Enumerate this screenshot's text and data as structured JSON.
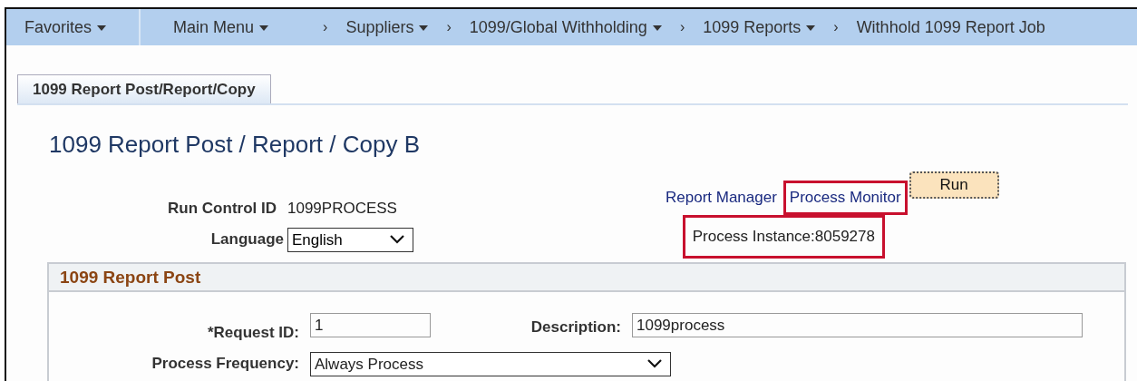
{
  "breadcrumb": [
    {
      "label": "Favorites",
      "dropdown": true
    },
    {
      "label": "Main Menu",
      "dropdown": true
    },
    {
      "label": "Suppliers",
      "dropdown": true,
      "separator": "›"
    },
    {
      "label": "1099/Global Withholding",
      "dropdown": true,
      "separator": "›"
    },
    {
      "label": "1099 Reports",
      "dropdown": true,
      "separator": "›"
    },
    {
      "label": "Withhold 1099 Report Job",
      "dropdown": false,
      "separator": "›"
    }
  ],
  "tabs": [
    {
      "label": "1099 Report Post/Report/Copy",
      "selected": true
    }
  ],
  "page_title": "1099 Report Post / Report / Copy B",
  "run_control": {
    "label": "Run Control ID",
    "value": "1099PROCESS"
  },
  "language": {
    "label": "Language",
    "value": "English"
  },
  "links": [
    {
      "label": "Report Manager",
      "highlighted": false
    },
    {
      "label": "Process Monitor",
      "highlighted": true
    }
  ],
  "run_button": "Run",
  "process_instance": {
    "text": "Process Instance:8059278",
    "highlighted": true
  },
  "group": {
    "title": "1099 Report Post",
    "request_id": {
      "label": "*Request ID:",
      "value": "1"
    },
    "description": {
      "label": "Description:",
      "value": "1099process"
    },
    "frequency": {
      "label": "Process Frequency:",
      "value": "Always Process"
    }
  }
}
